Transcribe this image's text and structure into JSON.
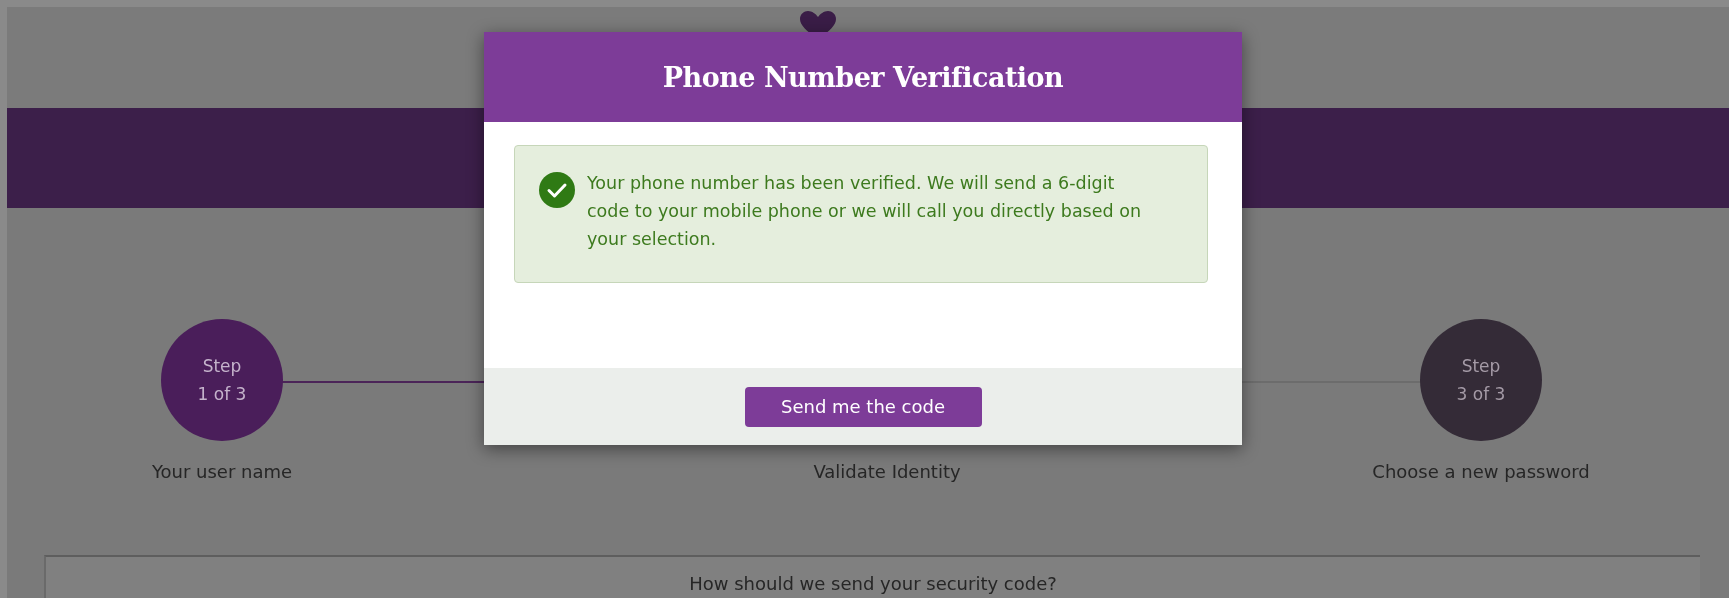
{
  "steps": [
    {
      "number": "Step",
      "of": "1 of 3",
      "label": "Your user name",
      "current": true
    },
    {
      "label": "Validate Identity"
    },
    {
      "number": "Step",
      "of": "3 of 3",
      "label": "Choose a new password",
      "current": false
    }
  ],
  "card": {
    "heading": "How should we send your security code?"
  },
  "modal": {
    "title": "Phone Number Verification",
    "message": "Your phone number has been verified. We will send a 6-digit code to your mobile phone or we will call you directly based on your selection.",
    "button": "Send me the code"
  }
}
